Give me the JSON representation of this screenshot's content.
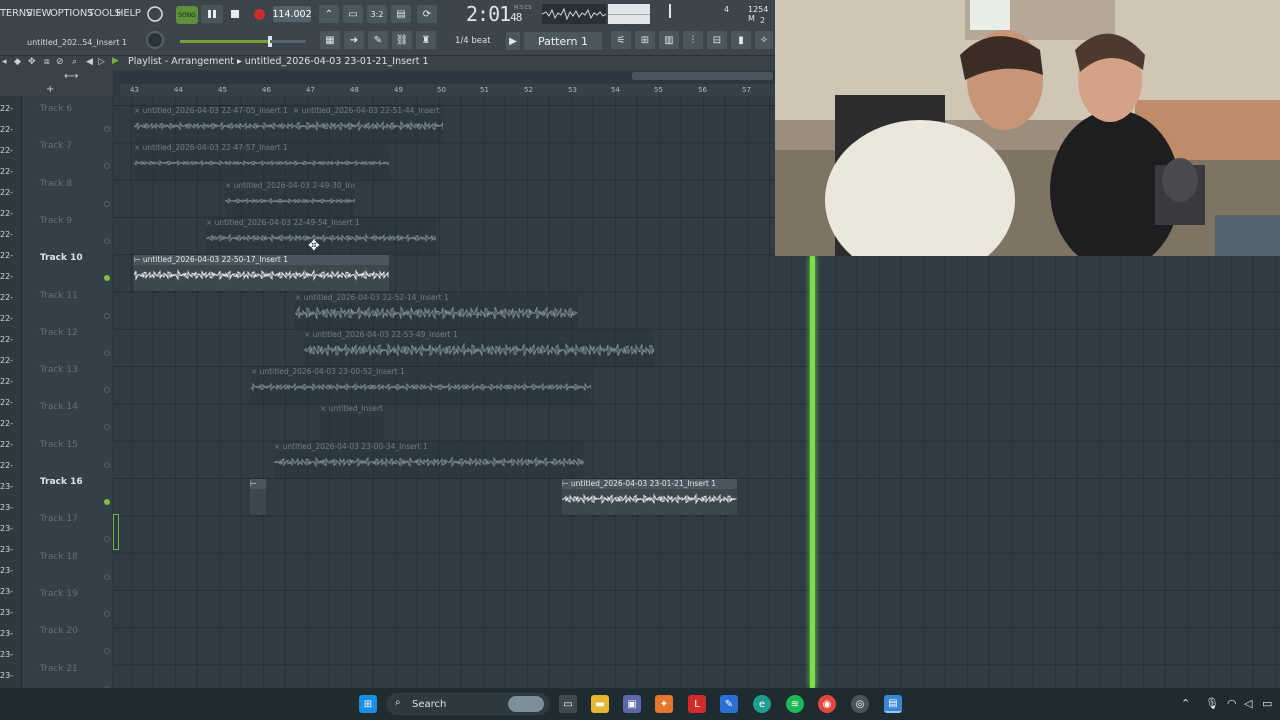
{
  "menu": {
    "patterns": "TERNS",
    "view": "VIEW",
    "options": "OPTIONS",
    "tools": "TOOLS",
    "help": "HELP"
  },
  "transport": {
    "mode": "SONG",
    "tempo": "114.002",
    "time_main": "2:01",
    "time_sub": "48",
    "time_unit": "M:S:CS",
    "meter_value": "4",
    "memory": "1254 M",
    "memory_extra": "2"
  },
  "hint": "untitled_202..54_Insert 1",
  "snap": "1/4 beat",
  "pattern": "Pattern 1",
  "playlist": {
    "title": "Playlist - Arrangement",
    "arrangement": "untitled_2026-04-03 23-01-21_Insert 1"
  },
  "ruler": [
    "43",
    "44",
    "45",
    "46",
    "47",
    "48",
    "49",
    "50",
    "51",
    "52",
    "53",
    "54",
    "55",
    "56",
    "57"
  ],
  "left_strip": [
    "22-",
    "22-",
    "22-",
    "22-",
    "22-",
    "22-",
    "22-",
    "22-",
    "22-",
    "22-",
    "22-",
    "22-",
    "22-",
    "22-",
    "22-",
    "22-",
    "22-",
    "22-",
    "23-",
    "23-",
    "23-",
    "23-",
    "23-",
    "23-",
    "23-",
    "23-",
    "23-",
    "23-"
  ],
  "tracks": [
    {
      "label": "Track 6",
      "active": false,
      "led": false
    },
    {
      "label": "Track 7",
      "active": false,
      "led": false
    },
    {
      "label": "Track 8",
      "active": false,
      "led": false
    },
    {
      "label": "Track 9",
      "active": false,
      "led": false
    },
    {
      "label": "Track 10",
      "active": true,
      "led": true
    },
    {
      "label": "Track 11",
      "active": false,
      "led": false
    },
    {
      "label": "Track 12",
      "active": false,
      "led": false
    },
    {
      "label": "Track 13",
      "active": false,
      "led": false
    },
    {
      "label": "Track 14",
      "active": false,
      "led": false
    },
    {
      "label": "Track 15",
      "active": false,
      "led": false
    },
    {
      "label": "Track 16",
      "active": true,
      "led": true
    },
    {
      "label": "Track 17",
      "active": false,
      "led": false
    },
    {
      "label": "Track 18",
      "active": false,
      "led": false
    },
    {
      "label": "Track 19",
      "active": false,
      "led": false
    },
    {
      "label": "Track 20",
      "active": false,
      "led": false
    },
    {
      "label": "Track 21",
      "active": false,
      "led": false
    }
  ],
  "clips": [
    {
      "name": "untitled_2026-04-03 22-47-05_Insert 1",
      "active": false
    },
    {
      "name": "untitled_2026-04-03 22-51-44_Insert 1",
      "active": false
    },
    {
      "name": "untitled_2026-04-03 22-47-57_Insert 1",
      "active": false
    },
    {
      "name": "untitled_2026-04-03 2-49-30_Insert 1",
      "active": false
    },
    {
      "name": "untitled_2026-04-03 22-49-54_Insert 1",
      "active": false
    },
    {
      "name": "untitled_2026-04-03 22-50-17_Insert 1",
      "active": true
    },
    {
      "name": "untitled_2026-04-03 22-52-14_Insert 1",
      "active": false
    },
    {
      "name": "untitled_2026-04-03 22-53-49_Insert 1",
      "active": false
    },
    {
      "name": "untitled_2026-04-03 23-00-52_Insert 1",
      "active": false
    },
    {
      "name": "untitled_Insert 1",
      "active": false
    },
    {
      "name": "untitled_2026-04-03 23-00-34_Insert 1",
      "active": false
    },
    {
      "name": "",
      "active": true
    },
    {
      "name": "untitled_2026-04-03 23-01-21_Insert 1",
      "active": true
    }
  ],
  "taskbar": {
    "search": "Search"
  },
  "colors": {
    "accent_green": "#7de04a",
    "record_red": "#c9302c",
    "background": "#2f3c45"
  }
}
